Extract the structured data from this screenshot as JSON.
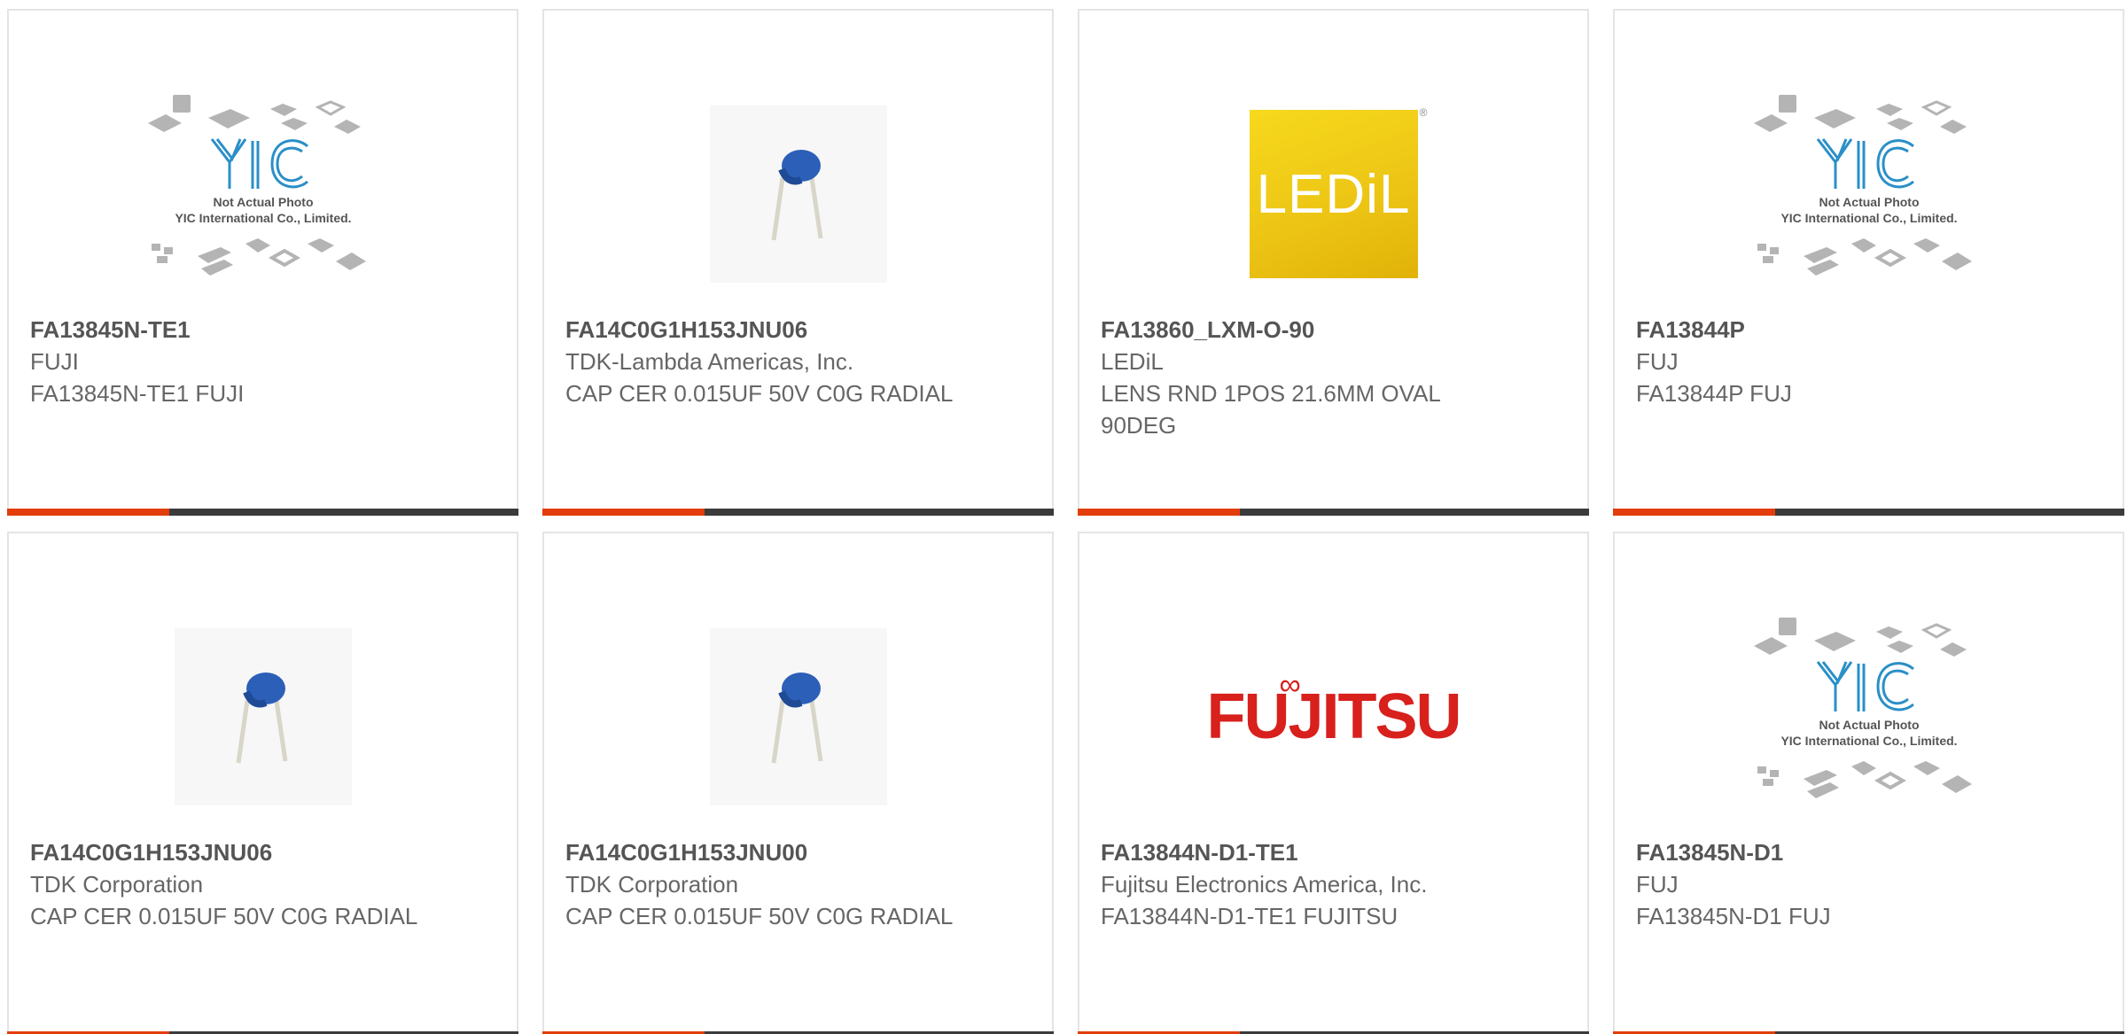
{
  "products": [
    {
      "part_number": "FA13845N-TE1",
      "manufacturer": "FUJI",
      "description": "FA13845N-TE1 FUJI",
      "image": "yic-placeholder",
      "placeholder_line1": "Not Actual Photo",
      "placeholder_line2": "YIC International Co., Limited."
    },
    {
      "part_number": "FA14C0G1H153JNU06",
      "manufacturer": "TDK-Lambda Americas, Inc.",
      "description": "CAP CER 0.015UF 50V C0G RADIAL",
      "image": "capacitor-photo"
    },
    {
      "part_number": "FA13860_LXM-O-90",
      "manufacturer": "LEDiL",
      "description": "LENS RND 1POS 21.6MM OVAL 90DEG",
      "image": "ledil-logo",
      "logo_text": "LEDiL",
      "logo_mark": "®"
    },
    {
      "part_number": "FA13844P",
      "manufacturer": "FUJ",
      "description": "FA13844P FUJ",
      "image": "yic-placeholder",
      "placeholder_line1": "Not Actual Photo",
      "placeholder_line2": "YIC International Co., Limited."
    },
    {
      "part_number": "FA14C0G1H153JNU06",
      "manufacturer": "TDK Corporation",
      "description": "CAP CER 0.015UF 50V C0G RADIAL",
      "image": "capacitor-photo"
    },
    {
      "part_number": "FA14C0G1H153JNU00",
      "manufacturer": "TDK Corporation",
      "description": "CAP CER 0.015UF 50V C0G RADIAL",
      "image": "capacitor-photo"
    },
    {
      "part_number": "FA13844N-D1-TE1",
      "manufacturer": "Fujitsu Electronics America, Inc.",
      "description": "FA13844N-D1-TE1 FUJITSU",
      "image": "fujitsu-logo",
      "logo_text": "FUJITSU"
    },
    {
      "part_number": "FA13845N-D1",
      "manufacturer": "FUJ",
      "description": "FA13845N-D1 FUJ",
      "image": "yic-placeholder",
      "placeholder_line1": "Not Actual Photo",
      "placeholder_line2": "YIC International Co., Limited."
    }
  ],
  "colors": {
    "accent": "#e23d0b",
    "bar": "#3b3b3b",
    "border": "#e4e4e4",
    "text": "#666666",
    "yic_blue": "#2a8fc8",
    "ledil_yellow": "#f2cf17",
    "fujitsu_red": "#d8201c",
    "capacitor_blue": "#2b5fb8"
  }
}
